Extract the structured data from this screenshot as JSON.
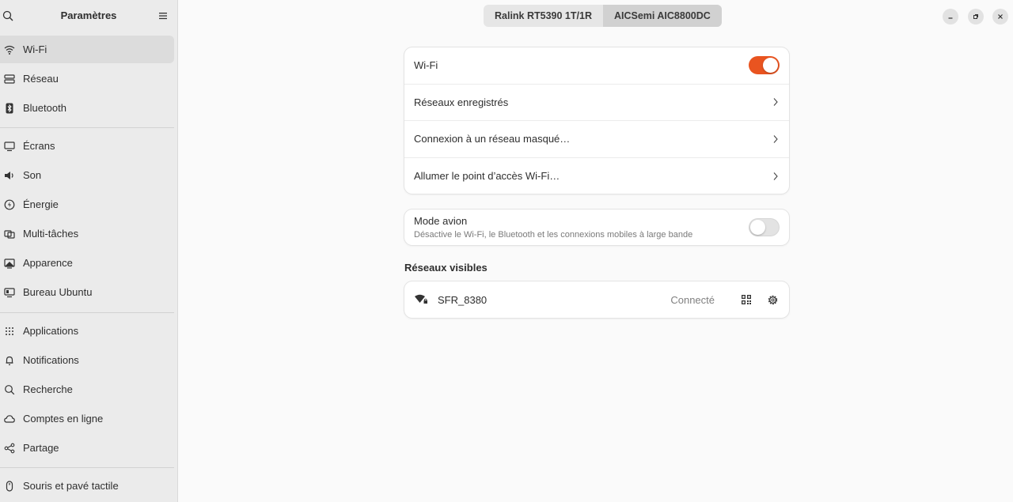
{
  "sidebar": {
    "title": "Paramètres",
    "items": [
      {
        "label": "Wi-Fi",
        "icon": "wifi-icon"
      },
      {
        "label": "Réseau",
        "icon": "network-icon"
      },
      {
        "label": "Bluetooth",
        "icon": "bluetooth-icon"
      },
      {
        "label": "Écrans",
        "icon": "display-icon"
      },
      {
        "label": "Son",
        "icon": "speaker-icon"
      },
      {
        "label": "Énergie",
        "icon": "power-icon"
      },
      {
        "label": "Multi-tâches",
        "icon": "multitasking-icon"
      },
      {
        "label": "Apparence",
        "icon": "appearance-icon"
      },
      {
        "label": "Bureau Ubuntu",
        "icon": "desktop-icon"
      },
      {
        "label": "Applications",
        "icon": "apps-grid-icon"
      },
      {
        "label": "Notifications",
        "icon": "bell-icon"
      },
      {
        "label": "Recherche",
        "icon": "search-icon"
      },
      {
        "label": "Comptes en ligne",
        "icon": "cloud-icon"
      },
      {
        "label": "Partage",
        "icon": "share-icon"
      },
      {
        "label": "Souris et pavé tactile",
        "icon": "mouse-icon"
      }
    ]
  },
  "tabs": [
    "Ralink RT5390 1T/1R",
    "AICSemi AIC8800DC"
  ],
  "selected_tab": "AICSemi AIC8800DC",
  "wifi_card": {
    "wifi_label": "Wi-Fi",
    "wifi_enabled": true,
    "saved_networks": "Réseaux enregistrés",
    "hidden_network": "Connexion à un réseau masqué…",
    "hotspot": "Allumer le point d’accès Wi-Fi…"
  },
  "airplane": {
    "title": "Mode avion",
    "subtitle": "Désactive le Wi-Fi, le Bluetooth et les connexions mobiles à large bande",
    "enabled": false
  },
  "visible_networks": {
    "title": "Réseaux visibles",
    "networks": [
      {
        "ssid": "SFR_8380",
        "status": "Connecté"
      }
    ]
  },
  "colors": {
    "accent": "#e95420"
  }
}
